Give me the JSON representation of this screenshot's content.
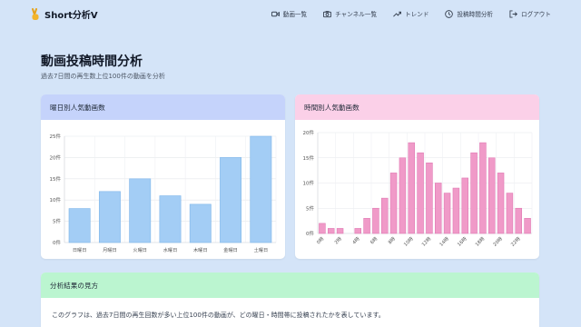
{
  "nav": {
    "brand": "Short分析V",
    "links": [
      {
        "label": "動画一覧",
        "icon": "video-icon"
      },
      {
        "label": "チャンネル一覧",
        "icon": "camera-icon"
      },
      {
        "label": "トレンド",
        "icon": "trend-icon"
      },
      {
        "label": "投稿時間分析",
        "icon": "clock-icon"
      },
      {
        "label": "ログアウト",
        "icon": "logout-icon"
      }
    ]
  },
  "page": {
    "title": "動画投稿時間分析",
    "subtitle": "過去7日間の再生数上位100件の動画を分析"
  },
  "cards": {
    "weekday_title": "曜日別人気動画数",
    "hour_title": "時間別人気動画数",
    "explain_title": "分析結果の見方",
    "explain_text": "このグラフは、過去7日間の再生回数が多い上位100件の動画が、どの曜日・時間帯に投稿されたかを表しています。"
  },
  "colors": {
    "weekday_bar": "#a3cdf5",
    "weekday_border": "#7fb6ea",
    "hour_bar": "#f09ac8",
    "hour_border": "#e07ab3"
  },
  "chart_data": [
    {
      "type": "bar",
      "categories": [
        "日曜日",
        "月曜日",
        "火曜日",
        "水曜日",
        "木曜日",
        "金曜日",
        "土曜日"
      ],
      "values": [
        8,
        12,
        15,
        11,
        9,
        20,
        25
      ],
      "ylim": [
        0,
        25
      ],
      "yticks": [
        "0件",
        "5件",
        "10件",
        "15件",
        "20件",
        "25件"
      ],
      "grid": true
    },
    {
      "type": "bar",
      "categories": [
        "0時",
        "1時",
        "2時",
        "3時",
        "4時",
        "5時",
        "6時",
        "7時",
        "8時",
        "9時",
        "10時",
        "11時",
        "12時",
        "13時",
        "14時",
        "15時",
        "16時",
        "17時",
        "18時",
        "19時",
        "20時",
        "21時",
        "22時",
        "23時"
      ],
      "tick_labels": [
        "0時",
        "2時",
        "4時",
        "6時",
        "8時",
        "10時",
        "12時",
        "14時",
        "16時",
        "18時",
        "20時",
        "22時"
      ],
      "values": [
        2,
        1,
        1,
        0,
        1,
        3,
        5,
        7,
        12,
        15,
        18,
        16,
        14,
        10,
        8,
        9,
        11,
        16,
        18,
        15,
        12,
        8,
        5,
        3
      ],
      "ylim": [
        0,
        20
      ],
      "yticks": [
        "0件",
        "5件",
        "10件",
        "15件",
        "20件"
      ],
      "grid": true
    }
  ]
}
